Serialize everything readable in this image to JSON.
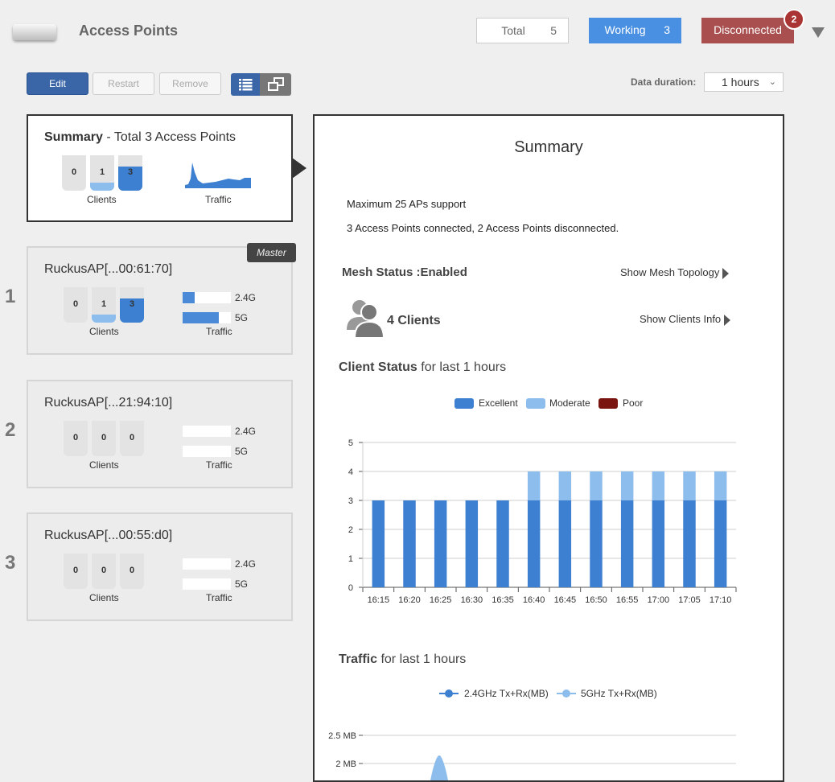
{
  "header": {
    "title": "Access Points",
    "total": {
      "label": "Total",
      "count": "5"
    },
    "working": {
      "label": "Working",
      "count": "3"
    },
    "disconnected": {
      "label": "Disconnected",
      "badge": "2"
    }
  },
  "toolbar": {
    "edit": "Edit",
    "restart": "Restart",
    "remove": "Remove",
    "duration_label": "Data duration:",
    "duration_value": "1 hours"
  },
  "summary_card": {
    "title_bold": "Summary",
    "title_rest": " - Total 3 Access Points",
    "client_counts": [
      "0",
      "1",
      "3"
    ],
    "clients_label": "Clients",
    "traffic_label": "Traffic"
  },
  "ap_cards": [
    {
      "index": "1",
      "name": "RuckusAP[...00:61:70]",
      "badge": "Master",
      "client_counts": [
        "0",
        "1",
        "3"
      ],
      "clients_label": "Clients",
      "traffic_label": "Traffic",
      "band_24": "2.4G",
      "band_5": "5G",
      "traffic_24_fraction": 0.25,
      "traffic_5_fraction": 0.75
    },
    {
      "index": "2",
      "name": "RuckusAP[...21:94:10]",
      "client_counts": [
        "0",
        "0",
        "0"
      ],
      "clients_label": "Clients",
      "traffic_label": "Traffic",
      "band_24": "2.4G",
      "band_5": "5G",
      "traffic_24_fraction": 0,
      "traffic_5_fraction": 0
    },
    {
      "index": "3",
      "name": "RuckusAP[...00:55:d0]",
      "client_counts": [
        "0",
        "0",
        "0"
      ],
      "clients_label": "Clients",
      "traffic_label": "Traffic",
      "band_24": "2.4G",
      "band_5": "5G",
      "traffic_24_fraction": 0,
      "traffic_5_fraction": 0
    }
  ],
  "panel": {
    "title": "Summary",
    "max_support": "Maximum 25 APs support",
    "connected_text": "3 Access Points connected, 2 Access Points disconnected.",
    "mesh_status": "Mesh Status :Enabled",
    "show_mesh": "Show Mesh Topology",
    "clients_count": "4 Clients",
    "show_clients": "Show Clients Info",
    "client_status_bold": "Client Status",
    "client_status_rest": " for last 1 hours",
    "traffic_bold": "Traffic",
    "traffic_rest": " for last 1 hours"
  },
  "colors": {
    "excellent": "#3d7fd0",
    "moderate": "#8dbdec",
    "poor": "#7a1410",
    "working": "#4a90e2",
    "disconnected": "#a94f4f"
  },
  "chart_data": [
    {
      "type": "bar",
      "stacked": true,
      "categories": [
        "16:15",
        "16:20",
        "16:25",
        "16:30",
        "16:35",
        "16:40",
        "16:45",
        "16:50",
        "16:55",
        "17:00",
        "17:05",
        "17:10"
      ],
      "series": [
        {
          "name": "Excellent",
          "values": [
            3,
            3,
            3,
            3,
            3,
            3,
            3,
            3,
            3,
            3,
            3,
            3
          ]
        },
        {
          "name": "Moderate",
          "values": [
            0,
            0,
            0,
            0,
            0,
            1,
            1,
            1,
            1,
            1,
            1,
            1
          ]
        },
        {
          "name": "Poor",
          "values": [
            0,
            0,
            0,
            0,
            0,
            0,
            0,
            0,
            0,
            0,
            0,
            0
          ]
        }
      ],
      "y_ticks": [
        "0",
        "1",
        "2",
        "3",
        "4",
        "5"
      ],
      "ylim": [
        0,
        5
      ],
      "grid": true,
      "legend": "top-center"
    },
    {
      "type": "line",
      "series": [
        {
          "name": "2.4GHz Tx+Rx(MB)"
        },
        {
          "name": "5GHz Tx+Rx(MB)"
        }
      ],
      "y_ticks": [
        "2.5 MB",
        "2 MB"
      ],
      "grid": true,
      "legend": "top-center",
      "note_visible": "peak of 5GHz series reaches about 2.1 MB"
    }
  ]
}
